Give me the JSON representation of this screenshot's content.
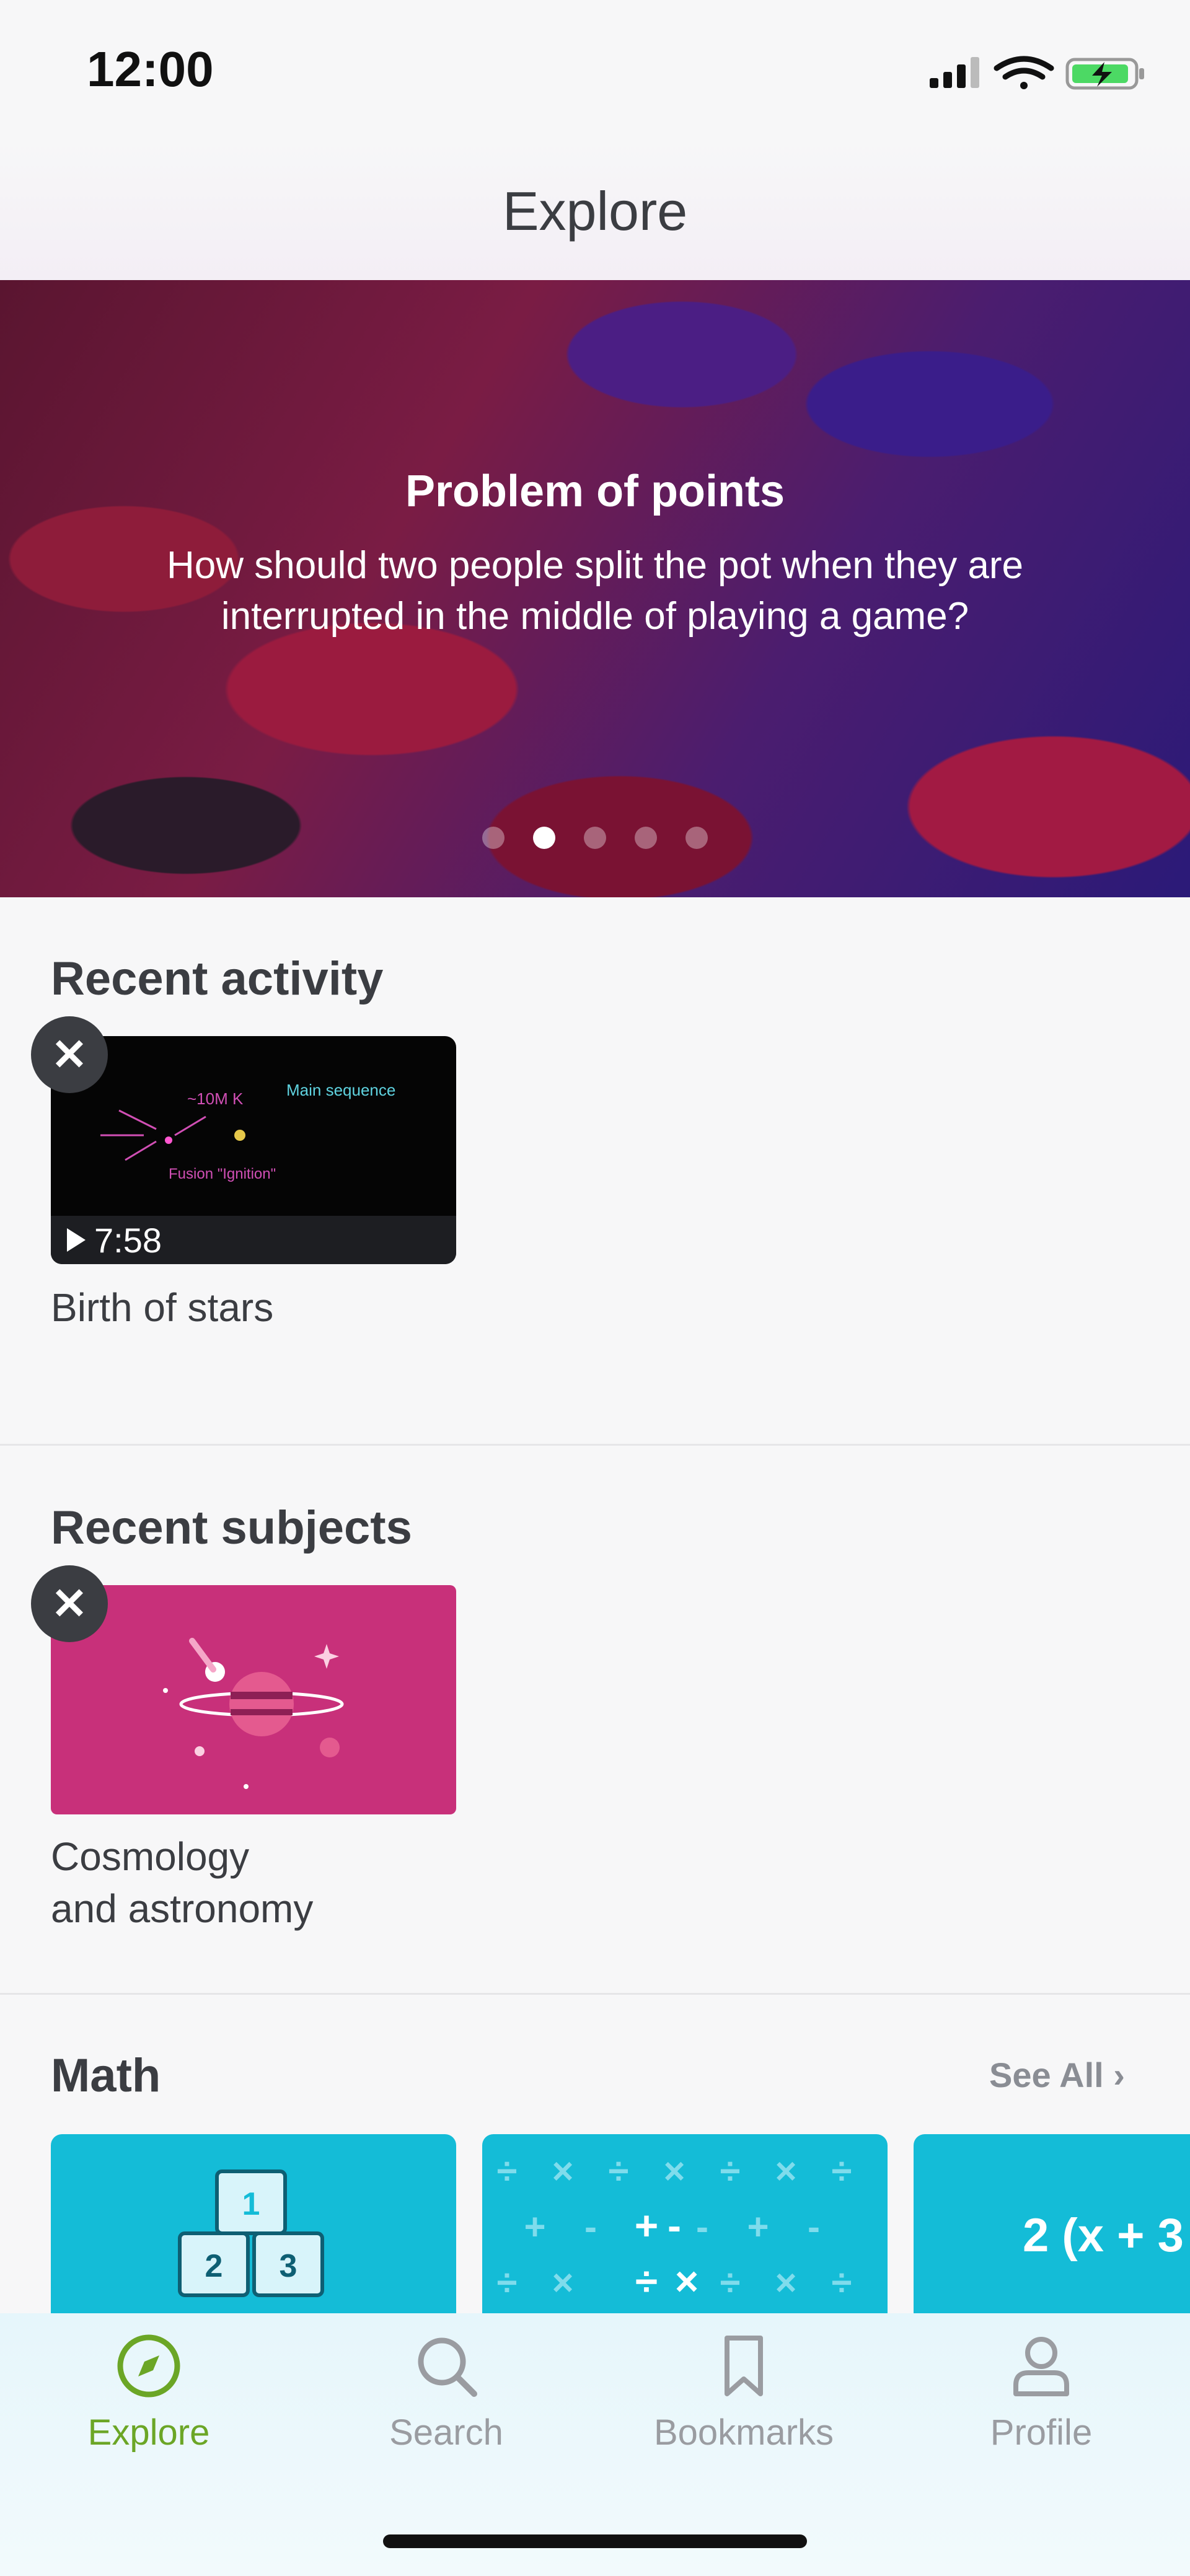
{
  "status_bar": {
    "time": "12:00"
  },
  "header": {
    "title": "Explore"
  },
  "hero": {
    "title": "Problem of points",
    "subtitle": "How should two people split the pot when they are interrupted in the middle of playing a game?",
    "page_count": 5,
    "active_page": 2
  },
  "recent_activity": {
    "title": "Recent activity",
    "items": [
      {
        "title": "Birth of stars",
        "duration": "7:58"
      }
    ]
  },
  "recent_subjects": {
    "title": "Recent subjects",
    "items": [
      {
        "title_line1": "Cosmology",
        "title_line2": "and astronomy"
      }
    ]
  },
  "math": {
    "title": "Math",
    "see_all": "See All",
    "card3_text": "2 (x + 3"
  },
  "tabs": [
    {
      "label": "Explore",
      "icon": "compass-icon",
      "active": true
    },
    {
      "label": "Search",
      "icon": "search-icon",
      "active": false
    },
    {
      "label": "Bookmarks",
      "icon": "bookmark-icon",
      "active": false
    },
    {
      "label": "Profile",
      "icon": "profile-icon",
      "active": false
    }
  ],
  "colors": {
    "accent": "#6ba626",
    "hero_dark": "#5a1530",
    "math_card": "#14bcd7",
    "subject_card": "#c8307a"
  }
}
